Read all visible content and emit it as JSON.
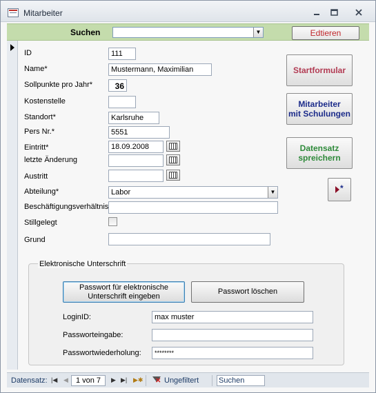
{
  "window": {
    "title": "Mitarbeiter",
    "controls": {
      "minimize": "🗕",
      "maximize": "🗖",
      "close": "✕"
    }
  },
  "header": {
    "search_label": "Suchen",
    "search_value": "",
    "edit_label": "Edtieren"
  },
  "form": {
    "id": {
      "label": "ID",
      "value": "111"
    },
    "name": {
      "label": "Name*",
      "value": "Mustermann, Maximilian"
    },
    "sollpunkte": {
      "label": "Sollpunkte pro Jahr*",
      "value": "36"
    },
    "kostenstelle": {
      "label": "Kostenstelle",
      "value": ""
    },
    "standort": {
      "label": "Standort*",
      "value": "Karlsruhe"
    },
    "persnr": {
      "label": "Pers Nr.*",
      "value": "5551"
    },
    "eintritt": {
      "label": "Eintritt*",
      "value": "18.09.2008"
    },
    "letzte_aenderung": {
      "label": "letzte Änderung",
      "value": ""
    },
    "austritt": {
      "label": "Austritt",
      "value": ""
    },
    "abteilung": {
      "label": "Abteilung*",
      "value": "Labor"
    },
    "beschaeftigung": {
      "label": "Beschäftigungsverhältnis",
      "value": ""
    },
    "stillgelegt": {
      "label": "Stillgelegt",
      "checked": false
    },
    "grund": {
      "label": "Grund",
      "value": ""
    }
  },
  "side_buttons": {
    "startformular": "Startformular",
    "schulungen_line1": "Mitarbeiter",
    "schulungen_line2": "mit Schulungen",
    "save_line1": "Datensatz",
    "save_line2": "spreichern",
    "new_record_icon": "new-record-icon"
  },
  "signature": {
    "legend": "Elektronische Unterschrift",
    "enter_pw_line1": "Passwort für elektronische",
    "enter_pw_line2": "Unterschrift eingeben",
    "delete_pw": "Passwort löschen",
    "loginid_label": "LoginID:",
    "loginid_value": "max muster",
    "pw_label": "Passworteingabe:",
    "pw_value": "",
    "pw_repeat_label": "Passwortwiederholung:",
    "pw_repeat_value": "********"
  },
  "navigation": {
    "label": "Datensatz:",
    "record_position": "1 von 7",
    "filter_label": "Ungefiltert",
    "search_placeholder": "Suchen"
  },
  "colors": {
    "header_band": "#c4dcac",
    "edit_text": "#c0262b",
    "start_text": "#b23b53",
    "schulung_text": "#1b2b8a",
    "save_text": "#2e8a3a"
  }
}
